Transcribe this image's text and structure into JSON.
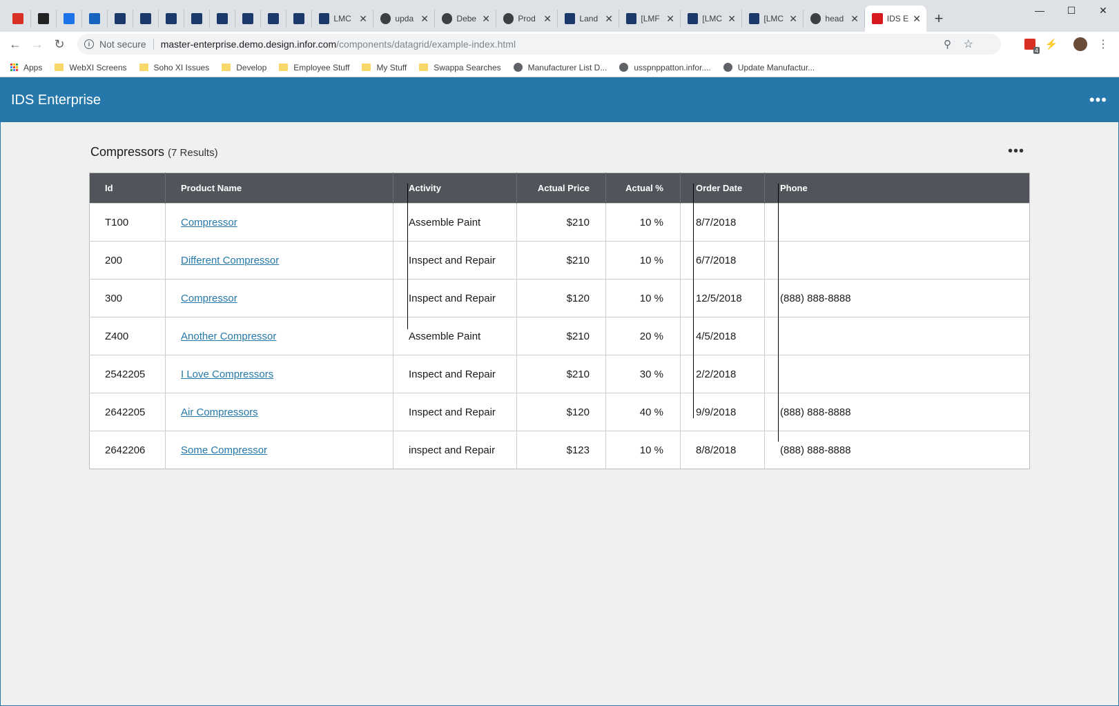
{
  "browser": {
    "tabs": [
      {
        "icon": "gmail-icon",
        "color": "#d93025",
        "label": ""
      },
      {
        "icon": "ms-icon",
        "color": "#222222",
        "label": ""
      },
      {
        "icon": "graduation-cap-icon",
        "color": "#1a73e8",
        "label": ""
      },
      {
        "icon": "bird-icon",
        "color": "#1565c0",
        "label": ""
      },
      {
        "icon": "jenkins-icon",
        "color": "#1b3a6b",
        "label": ""
      },
      {
        "icon": "jenkins-icon",
        "color": "#1b3a6b",
        "label": ""
      },
      {
        "icon": "jenkins-icon",
        "color": "#1b3a6b",
        "label": ""
      },
      {
        "icon": "jenkins-icon",
        "color": "#1b3a6b",
        "label": ""
      },
      {
        "icon": "jenkins-icon",
        "color": "#1b3a6b",
        "label": ""
      },
      {
        "icon": "jenkins-icon",
        "color": "#1b3a6b",
        "label": ""
      },
      {
        "icon": "jenkins-icon",
        "color": "#1b3a6b",
        "label": ""
      },
      {
        "icon": "jenkins-icon",
        "color": "#1b3a6b",
        "label": ""
      }
    ],
    "wide_tabs": [
      {
        "icon": "shield-icon",
        "label": "LMC"
      },
      {
        "icon": "github-icon",
        "label": "upda"
      },
      {
        "icon": "globe-icon",
        "label": "Debe"
      },
      {
        "icon": "globe-icon",
        "label": "Prod"
      },
      {
        "icon": "jenkins-icon",
        "label": "Land"
      },
      {
        "icon": "jenkins-icon",
        "label": "[LMF"
      },
      {
        "icon": "jenkins-icon",
        "label": "[LMC"
      },
      {
        "icon": "jenkins-icon",
        "label": "[LMC"
      },
      {
        "icon": "github-icon",
        "label": "head"
      }
    ],
    "active_tab": {
      "icon": "infor-icon",
      "label": "IDS E"
    },
    "new_tab": "+",
    "security_label": "Not secure",
    "url_host": "master-enterprise.demo.design.infor.com",
    "url_path": "/components/datagrid/example-index.html",
    "extension_badge": "4",
    "bookmarks": [
      {
        "type": "apps",
        "label": "Apps"
      },
      {
        "type": "folder",
        "label": "WebXI Screens"
      },
      {
        "type": "folder",
        "label": "Soho XI Issues"
      },
      {
        "type": "folder",
        "label": "Develop"
      },
      {
        "type": "folder",
        "label": "Employee Stuff"
      },
      {
        "type": "folder",
        "label": "My Stuff"
      },
      {
        "type": "folder",
        "label": "Swappa Searches"
      },
      {
        "type": "globe",
        "label": "Manufacturer List D..."
      },
      {
        "type": "globe",
        "label": "usspnppatton.infor...."
      },
      {
        "type": "globe",
        "label": "Update Manufactur..."
      }
    ]
  },
  "app": {
    "title": "IDS Enterprise",
    "header_color": "#2578a9"
  },
  "grid": {
    "title": "Compressors",
    "count": "(7 Results)",
    "columns": [
      "Id",
      "Product Name",
      "Activity",
      "Actual Price",
      "Actual %",
      "Order Date",
      "Phone"
    ],
    "rows": [
      {
        "id": "T100",
        "name": "Compressor",
        "activity": "Assemble Paint",
        "price": "$210",
        "pct": "10 %",
        "date": "8/7/2018",
        "phone": ""
      },
      {
        "id": "200",
        "name": "Different Compressor",
        "activity": "Inspect and Repair",
        "price": "$210",
        "pct": "10 %",
        "date": "6/7/2018",
        "phone": ""
      },
      {
        "id": "300",
        "name": "Compressor",
        "activity": "Inspect and Repair",
        "price": "$120",
        "pct": "10 %",
        "date": "12/5/2018",
        "phone": "(888) 888-8888"
      },
      {
        "id": "Z400",
        "name": "Another Compressor",
        "activity": "Assemble Paint",
        "price": "$210",
        "pct": "20 %",
        "date": "4/5/2018",
        "phone": ""
      },
      {
        "id": "2542205",
        "name": "I Love Compressors",
        "activity": "Inspect and Repair",
        "price": "$210",
        "pct": "30 %",
        "date": "2/2/2018",
        "phone": ""
      },
      {
        "id": "2642205",
        "name": "Air Compressors",
        "activity": "Inspect and Repair",
        "price": "$120",
        "pct": "40 %",
        "date": "9/9/2018",
        "phone": "(888) 888-8888"
      },
      {
        "id": "2642206",
        "name": "Some Compressor",
        "activity": "inspect and Repair",
        "price": "$123",
        "pct": "10 %",
        "date": "8/8/2018",
        "phone": "(888) 888-8888"
      }
    ]
  }
}
